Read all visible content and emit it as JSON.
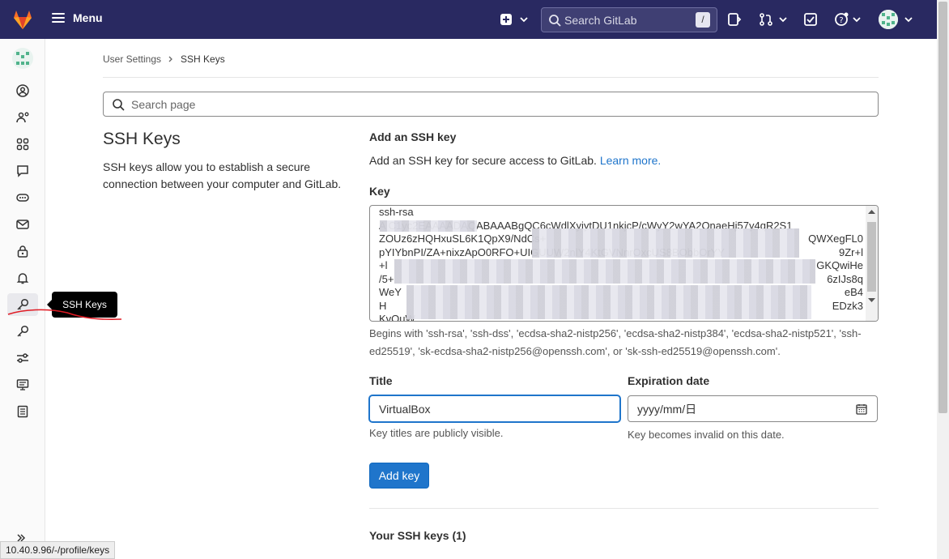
{
  "topbar": {
    "menu_label": "Menu",
    "search_placeholder": "Search GitLab",
    "search_shortcut": "/"
  },
  "sidebar": {
    "tooltip": "SSH Keys",
    "items": [
      "profile",
      "account",
      "applications",
      "chat",
      "access-tokens",
      "emails",
      "password",
      "notifications",
      "ssh-keys",
      "gpg-keys",
      "preferences",
      "active-sessions",
      "authentication-log"
    ]
  },
  "breadcrumb": {
    "parent": "User Settings",
    "current": "SSH Keys"
  },
  "page_search": {
    "placeholder": "Search page"
  },
  "intro": {
    "title": "SSH Keys",
    "description": "SSH keys allow you to establish a secure connection between your computer and GitLab."
  },
  "add_key": {
    "heading": "Add an SSH key",
    "text": "Add an SSH key for secure access to GitLab.",
    "learn_more": "Learn more.",
    "key_label": "Key",
    "key_lines": [
      "ssh-rsa",
      "A                         C1yc2EAAAADAQABAAABgQC6cWdlXyiytDU1nkjcP/cWyY2wYA2OnaeHj57y4qR2S1",
      "ZOUz6zHQHxuSL6K1QpX9/NdCs+",
      "pYIYbnPI/ZA+nixzApO0RFO+UIGUUW2nlY4KtGVNnrOxcUS8BObbOrYY",
      "+l",
      "/5+",
      "WeY                                                             ",
      "H",
      "KvQuW"
    ],
    "key_right_fragments": [
      "QWXegFL0",
      "9Zr+l",
      "GKQwiHe",
      "6zIJs8q",
      "eB4",
      "EDzk3"
    ],
    "key_help": "Begins with 'ssh-rsa', 'ssh-dss', 'ecdsa-sha2-nistp256', 'ecdsa-sha2-nistp384', 'ecdsa-sha2-nistp521', 'ssh-ed25519', 'sk-ecdsa-sha2-nistp256@openssh.com', or 'sk-ssh-ed25519@openssh.com'.",
    "title_label": "Title",
    "title_value": "VirtualBox",
    "title_help": "Key titles are publicly visible.",
    "expiration_label": "Expiration date",
    "expiration_placeholder": "yyyy/mm/日",
    "expiration_help": "Key becomes invalid on this date.",
    "submit_label": "Add key"
  },
  "your_keys": {
    "heading": "Your SSH keys (1)"
  },
  "status_url": "10.40.9.96/-/profile/keys",
  "colors": {
    "topbar": "#292961",
    "primary": "#1f75cb",
    "annotation": "#e01b24"
  }
}
